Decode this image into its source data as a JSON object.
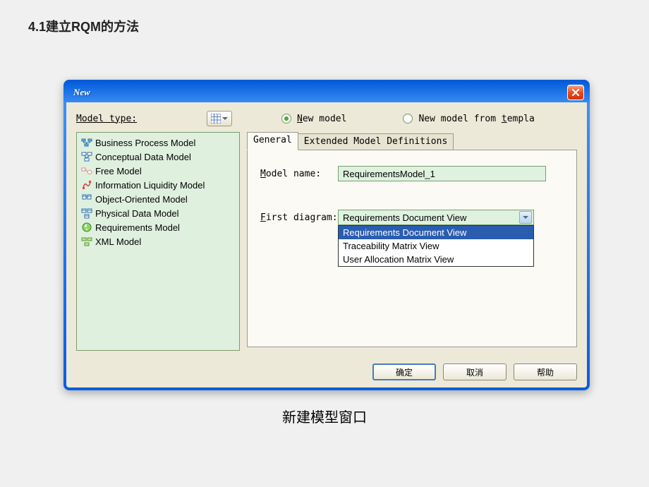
{
  "heading": "4.1建立RQM的方法",
  "caption": "新建模型窗口",
  "dialog": {
    "title": "New",
    "model_type_label": "Model type:",
    "radio_new": "New model",
    "radio_template": "New model from templa",
    "tabs": {
      "general": "General",
      "extended": "Extended Model Definitions"
    },
    "model_name_label": "Model name:",
    "model_name_value": "RequirementsModel_1",
    "first_diagram_label": "First diagram:",
    "first_diagram_value": "Requirements Document View",
    "dropdown_options": [
      "Requirements Document View",
      "Traceability Matrix View",
      "User Allocation Matrix View"
    ],
    "models": [
      "Business Process Model",
      "Conceptual Data Model",
      "Free Model",
      "Information Liquidity Model",
      "Object-Oriented Model",
      "Physical Data Model",
      "Requirements Model",
      "XML Model"
    ],
    "buttons": {
      "ok": "确定",
      "cancel": "取消",
      "help": "帮助"
    }
  }
}
